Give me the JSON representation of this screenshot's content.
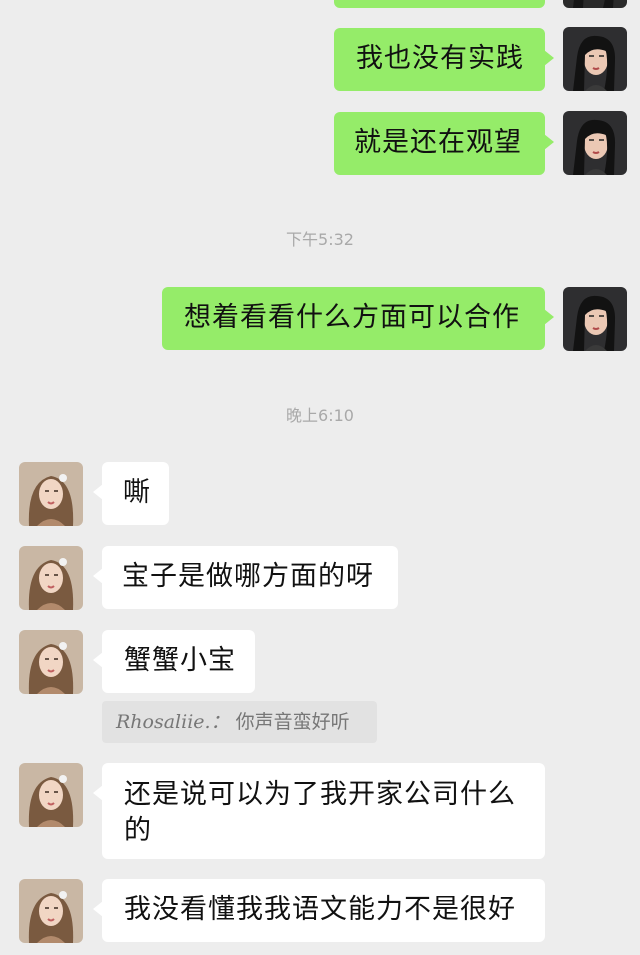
{
  "messages": [
    {
      "side": "sent",
      "text": ""
    },
    {
      "side": "sent",
      "text": "我也没有实践"
    },
    {
      "side": "sent",
      "text": "就是还在观望"
    },
    {
      "side": "sent",
      "text": "想着看看什么方面可以合作"
    },
    {
      "side": "recv",
      "text": "嘶"
    },
    {
      "side": "recv",
      "text": "宝子是做哪方面的呀"
    },
    {
      "side": "recv",
      "text": "蟹蟹小宝"
    },
    {
      "side": "recv",
      "text": "还是说可以为了我开家公司什么的"
    },
    {
      "side": "recv",
      "text": "我没看懂我我语文能力不是很好"
    }
  ],
  "timestamps": [
    "下午5:32",
    "晚上6:10"
  ],
  "quote": {
    "name": "Rhosaliie.：",
    "text": "你声音蛮好听"
  },
  "colors": {
    "background": "#ededed",
    "sent_bubble": "#95ec69",
    "received_bubble": "#ffffff",
    "timestamp_text": "#a9a9a9",
    "quote_background": "#e2e2e2"
  },
  "avatars": {
    "self": "avatar-dark-hair-woman",
    "other": "avatar-long-hair-girl"
  }
}
